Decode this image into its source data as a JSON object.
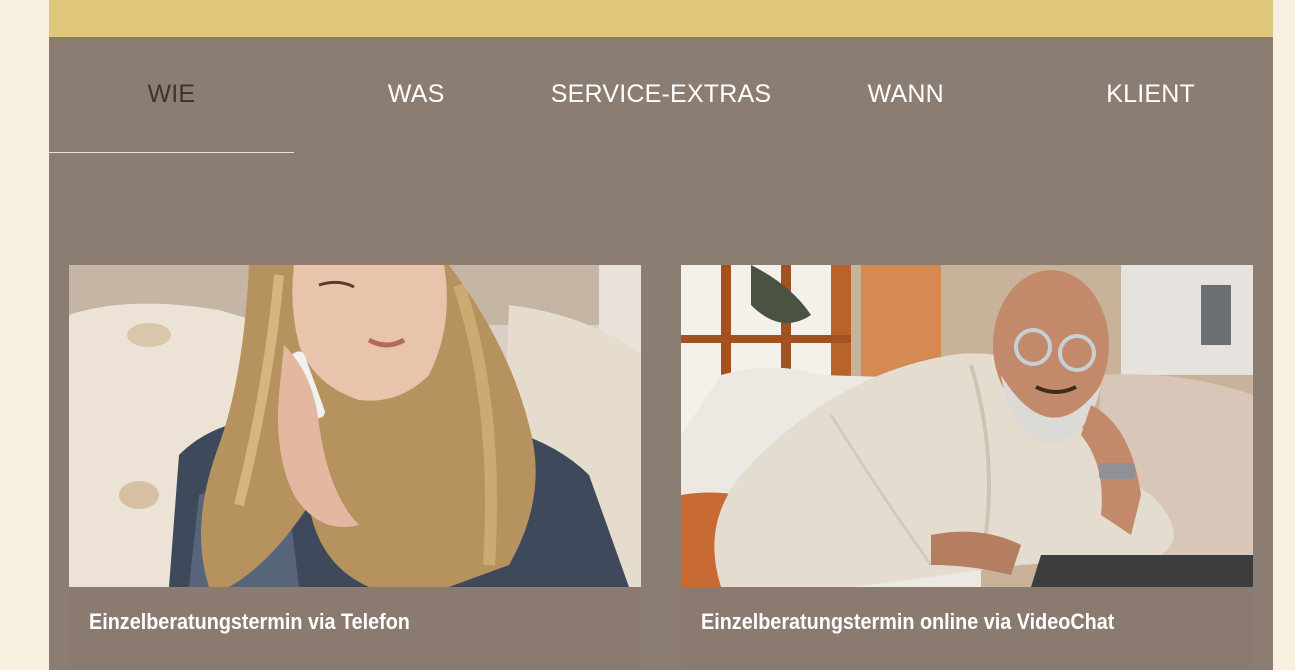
{
  "tabs": [
    {
      "label": "WIE",
      "active": true
    },
    {
      "label": "WAS",
      "active": false
    },
    {
      "label": "SERVICE-EXTRAS",
      "active": false
    },
    {
      "label": "WANN",
      "active": false
    },
    {
      "label": "KLIENT",
      "active": false
    }
  ],
  "cards": [
    {
      "caption": "Einzelberatungstermin via Telefon"
    },
    {
      "caption": "Einzelberatungstermin online via VideoChat"
    }
  ],
  "colors": {
    "page_background": "#f7f0df",
    "top_bar": "#dfc77c",
    "panel": "#8c7d72",
    "active_tab_text": "#3b3430",
    "tab_text": "#ffffff"
  }
}
